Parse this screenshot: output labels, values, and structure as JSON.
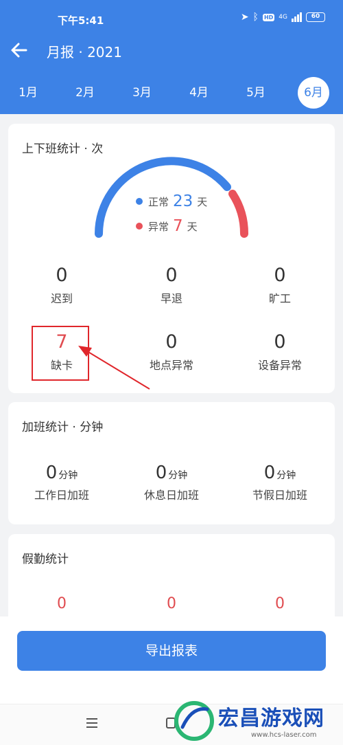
{
  "status_bar": {
    "time": "下午5:41",
    "hd": "HD",
    "network": "4G",
    "battery": "60"
  },
  "header": {
    "title": "月报 · 2021"
  },
  "months": {
    "items": [
      "1月",
      "2月",
      "3月",
      "4月",
      "5月",
      "6月"
    ],
    "selected": "6月"
  },
  "attendance": {
    "title": "上下班统计 · 次",
    "normal": {
      "label": "正常",
      "value": "23",
      "unit": "天",
      "color": "#3d82e6"
    },
    "abnormal": {
      "label": "异常",
      "value": "7",
      "unit": "天",
      "color": "#e9525a"
    },
    "stats": [
      {
        "value": "0",
        "label": "迟到"
      },
      {
        "value": "0",
        "label": "早退"
      },
      {
        "value": "0",
        "label": "旷工"
      },
      {
        "value": "7",
        "label": "缺卡"
      },
      {
        "value": "0",
        "label": "地点异常"
      },
      {
        "value": "0",
        "label": "设备异常"
      }
    ]
  },
  "overtime": {
    "title": "加班统计 · 分钟",
    "unit": "分钟",
    "stats": [
      {
        "value": "0",
        "label": "工作日加班"
      },
      {
        "value": "0",
        "label": "休息日加班"
      },
      {
        "value": "0",
        "label": "节假日加班"
      }
    ]
  },
  "leave": {
    "title": "假勤统计",
    "values": [
      "0",
      "0",
      "0"
    ]
  },
  "export_button": "导出报表",
  "watermark": {
    "text": "宏昌游戏网",
    "url": "www.hcs-laser.com"
  },
  "colors": {
    "primary": "#3d82e6",
    "danger": "#e9525a",
    "annotation": "#e0262b"
  }
}
